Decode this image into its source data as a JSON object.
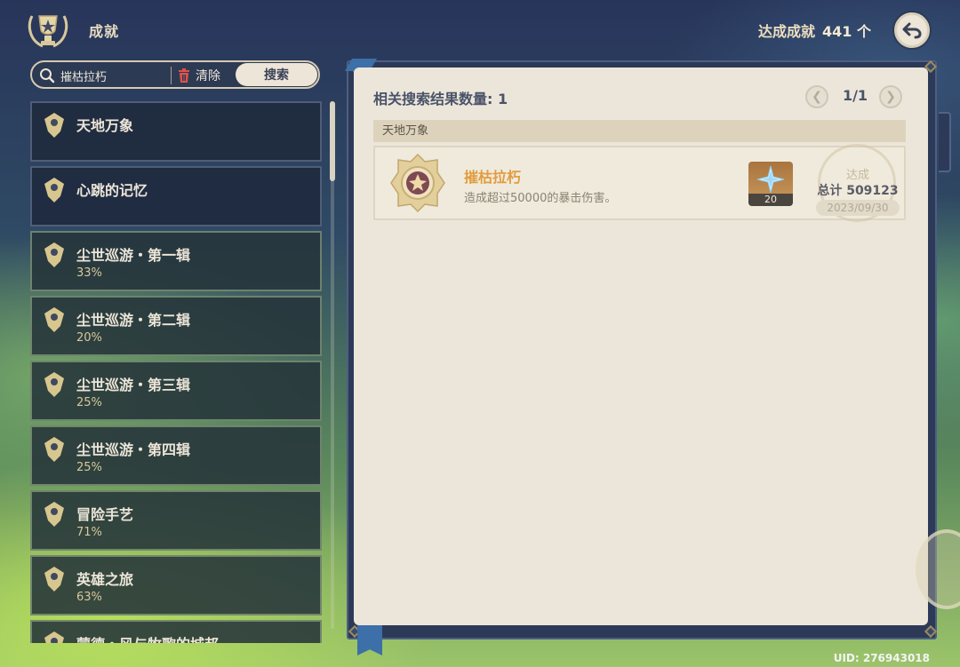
{
  "header": {
    "title": "成就",
    "achievements_label": "达成成就",
    "achievements_count": "441 个",
    "emblem_icon": "trophy-emblem-icon",
    "back_icon": "back-arrow-icon"
  },
  "search": {
    "value": "摧枯拉朽",
    "clear_label": "清除",
    "search_label": "搜索"
  },
  "categories": [
    {
      "name": "天地万象",
      "percent": ""
    },
    {
      "name": "心跳的记忆",
      "percent": ""
    },
    {
      "name": "尘世巡游・第一辑",
      "percent": "33%"
    },
    {
      "name": "尘世巡游・第二辑",
      "percent": "20%"
    },
    {
      "name": "尘世巡游・第三辑",
      "percent": "25%"
    },
    {
      "name": "尘世巡游・第四辑",
      "percent": "25%"
    },
    {
      "name": "冒险手艺",
      "percent": "71%"
    },
    {
      "name": "英雄之旅",
      "percent": "63%"
    },
    {
      "name": "蒙德・风与牧歌的城邦",
      "percent": ""
    }
  ],
  "results": {
    "count_label": "相关搜索结果数量: 1",
    "page": "1/1",
    "group": "天地万象",
    "achievement": {
      "name": "摧枯拉朽",
      "description": "造成超过50000的暴击伤害。",
      "reward_qty": "20",
      "reward_icon": "primogem-icon",
      "status": "达成",
      "total": "总计 509123",
      "date": "2023/09/30"
    }
  },
  "uid": "UID: 276943018",
  "colors": {
    "accent_orange": "#e29c3f",
    "paper": "#ece6da",
    "frame": "#2c3a58",
    "text_light": "#ece5d8"
  }
}
